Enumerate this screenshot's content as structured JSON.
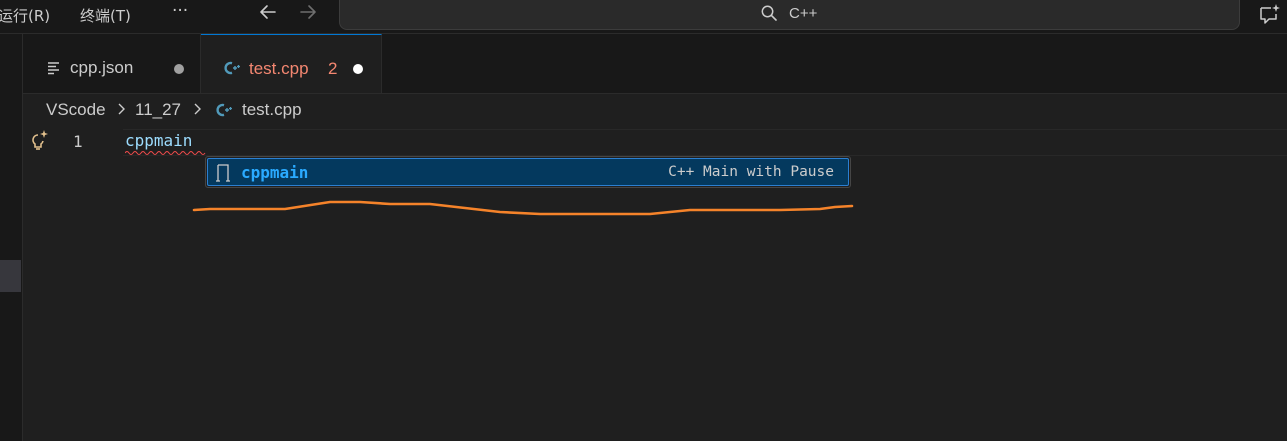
{
  "menu": {
    "run_label": "运行(R)",
    "terminal_label": "终端(T)",
    "more_label": "···"
  },
  "nav": {
    "back_icon": "arrow-left-icon",
    "forward_icon": "arrow-right-icon"
  },
  "search": {
    "text": "C++",
    "icon": "search-icon"
  },
  "tabs": [
    {
      "label": "cpp.json",
      "icon": "json-file-icon",
      "modified": true,
      "active": false
    },
    {
      "label": "test.cpp",
      "badge": "2",
      "icon": "cpp-file-icon",
      "modified": true,
      "active": true
    }
  ],
  "breadcrumb": [
    "VScode",
    "11_27",
    "test.cpp"
  ],
  "editor": {
    "line_number": "1",
    "code": "cppmain"
  },
  "suggestion": {
    "label": "cppmain",
    "detail": "C++ Main with Pause",
    "icon": "snippet-icon"
  },
  "colors": {
    "accent": "#0078d4",
    "error": "#f14c4c",
    "tab_modified_text": "#f48771",
    "suggestion_highlight": "#2aaaff",
    "annotation_stroke": "#f5832a",
    "cpp_icon": "#519aba",
    "bulb": "#e2c08d"
  }
}
